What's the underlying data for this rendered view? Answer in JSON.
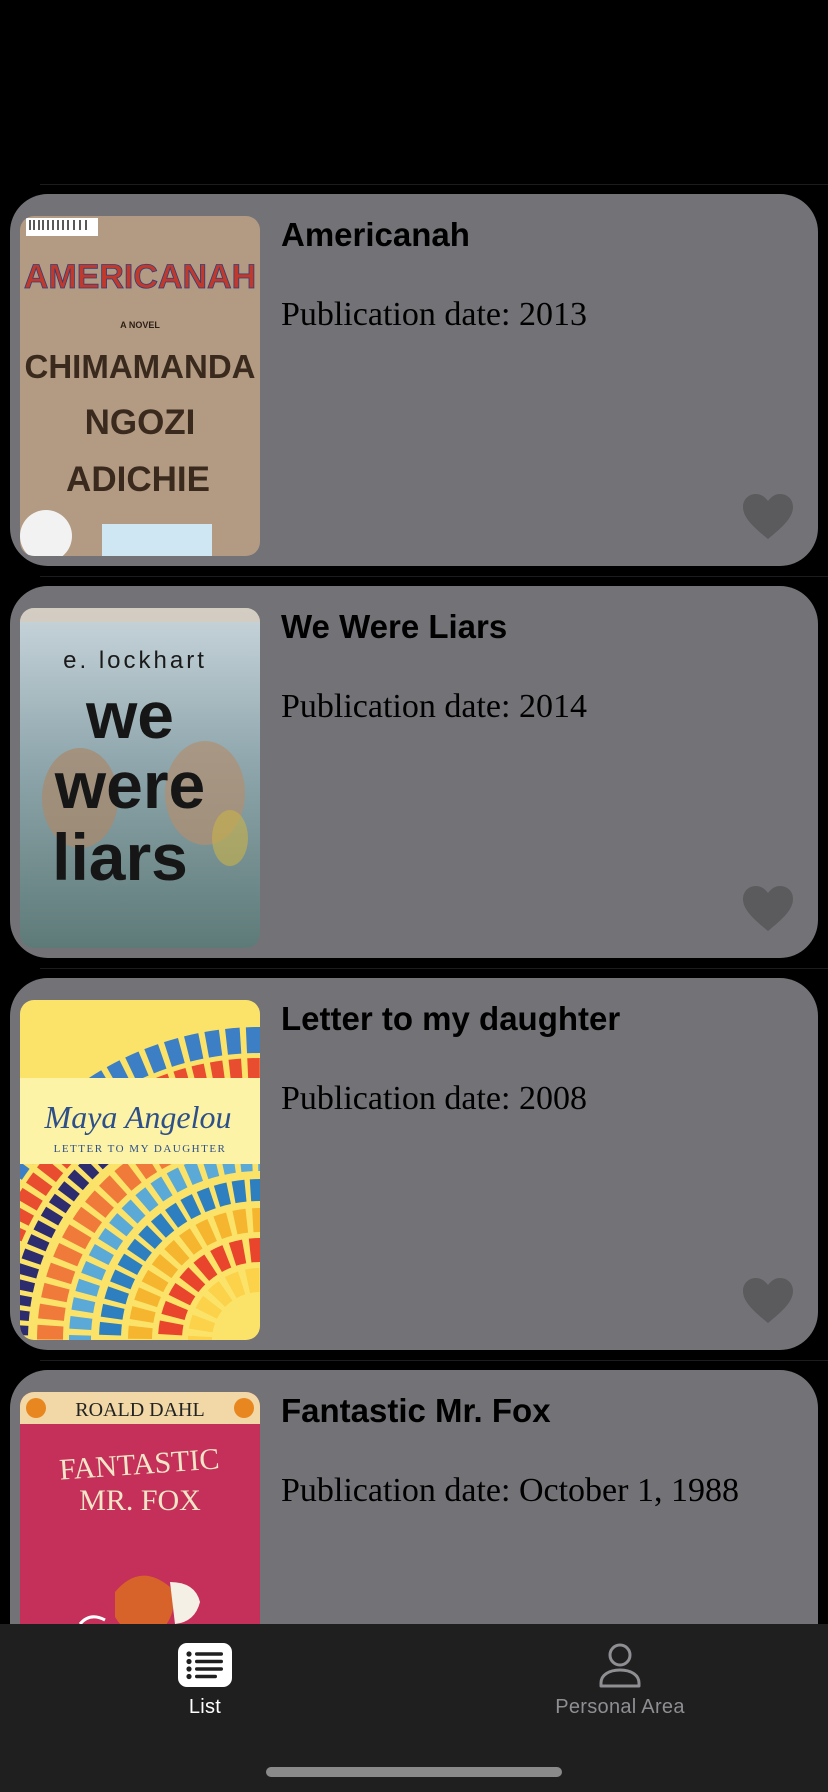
{
  "colors": {
    "background": "#000000",
    "card": "#737377",
    "heart": "#5b5b5e",
    "tabbar": "#1f1f1f",
    "tab_active": "#ffffff",
    "tab_inactive": "#8e8e93"
  },
  "books": [
    {
      "title": "Americanah",
      "date_label": "Publication date: 2013",
      "cover": {
        "lines": [
          "AMERICANAH",
          "A NOVEL",
          "CHIMAMANDA",
          "NGOZI",
          "ADICHIE"
        ]
      },
      "favorite_icon": "heart-icon"
    },
    {
      "title": "We Were Liars",
      "date_label": "Publication date: 2014",
      "cover": {
        "lines": [
          "e. lockhart",
          "we",
          "were",
          "liars"
        ]
      },
      "favorite_icon": "heart-icon"
    },
    {
      "title": "Letter to my daughter",
      "date_label": "Publication date: 2008",
      "cover": {
        "lines": [
          "Maya Angelou",
          "LETTER TO MY DAUGHTER"
        ]
      },
      "favorite_icon": "heart-icon"
    },
    {
      "title": "Fantastic Mr. Fox",
      "date_label": "Publication date: October 1, 1988",
      "cover": {
        "lines": [
          "ROALD DAHL",
          "FANTASTIC",
          "MR. FOX"
        ]
      }
    }
  ],
  "tabbar": {
    "tabs": [
      {
        "label": "List",
        "icon": "list-icon",
        "active": true
      },
      {
        "label": "Personal Area",
        "icon": "person-icon",
        "active": false
      }
    ]
  }
}
